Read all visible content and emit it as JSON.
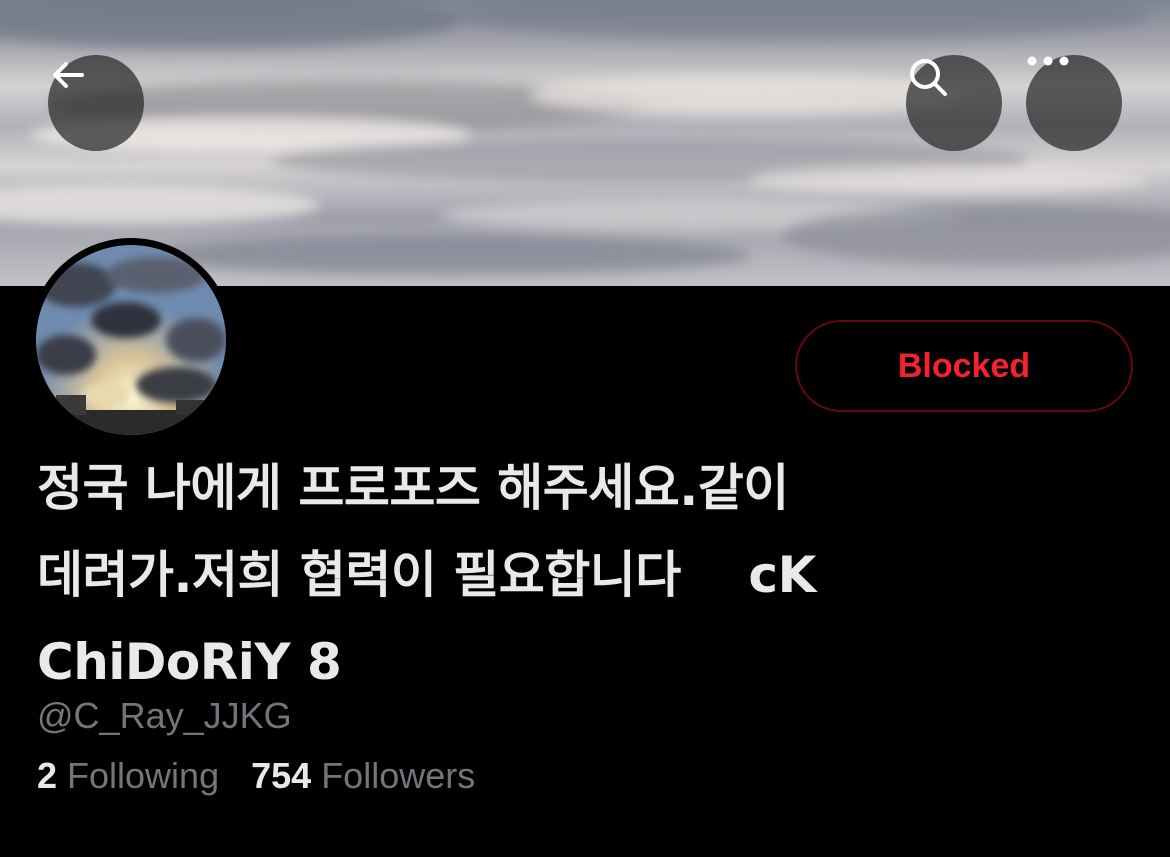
{
  "header": {
    "back_icon": "arrow-left-icon",
    "search_icon": "search-icon",
    "more_icon": "more-horizontal-icon"
  },
  "profile": {
    "action_button_label": "Blocked",
    "action_button_color": "#f4212e",
    "display_name": "정국 나에게 프로포즈 해주세요.같이\n데려가.저희 협력이 필요합니다    cK\nChiDoRiY 8",
    "handle": "@C_Ray_JJKG",
    "following_count": "2",
    "following_label": "Following",
    "followers_count": "754",
    "followers_label": "Followers"
  }
}
